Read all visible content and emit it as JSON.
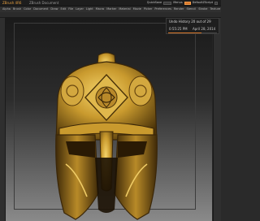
{
  "titlebar": {
    "app_name": "ZBrush 4R6",
    "doc_title": "ZBrush Document",
    "quicksave_label": "QuickSave",
    "menus_label": "Menus",
    "script_label": "DefaultZScript"
  },
  "menubar": {
    "items": [
      "Alpha",
      "Brush",
      "Color",
      "Document",
      "Draw",
      "Edit",
      "File",
      "Layer",
      "Light",
      "Macro",
      "Marker",
      "Material",
      "Movie",
      "Picker",
      "Preferences",
      "Render",
      "Stencil",
      "Stroke",
      "Texture",
      "Tool",
      "Transform",
      "Zplugin",
      "Zscript"
    ]
  },
  "undo_history": {
    "title": "Undo History 20 out of 29",
    "time": "0:55:25 PM",
    "date": "April 28, 2014",
    "position": 20,
    "total": 29
  },
  "colors": {
    "accent": "#d9772a",
    "gold": "#c9a035",
    "background": "#262626"
  }
}
